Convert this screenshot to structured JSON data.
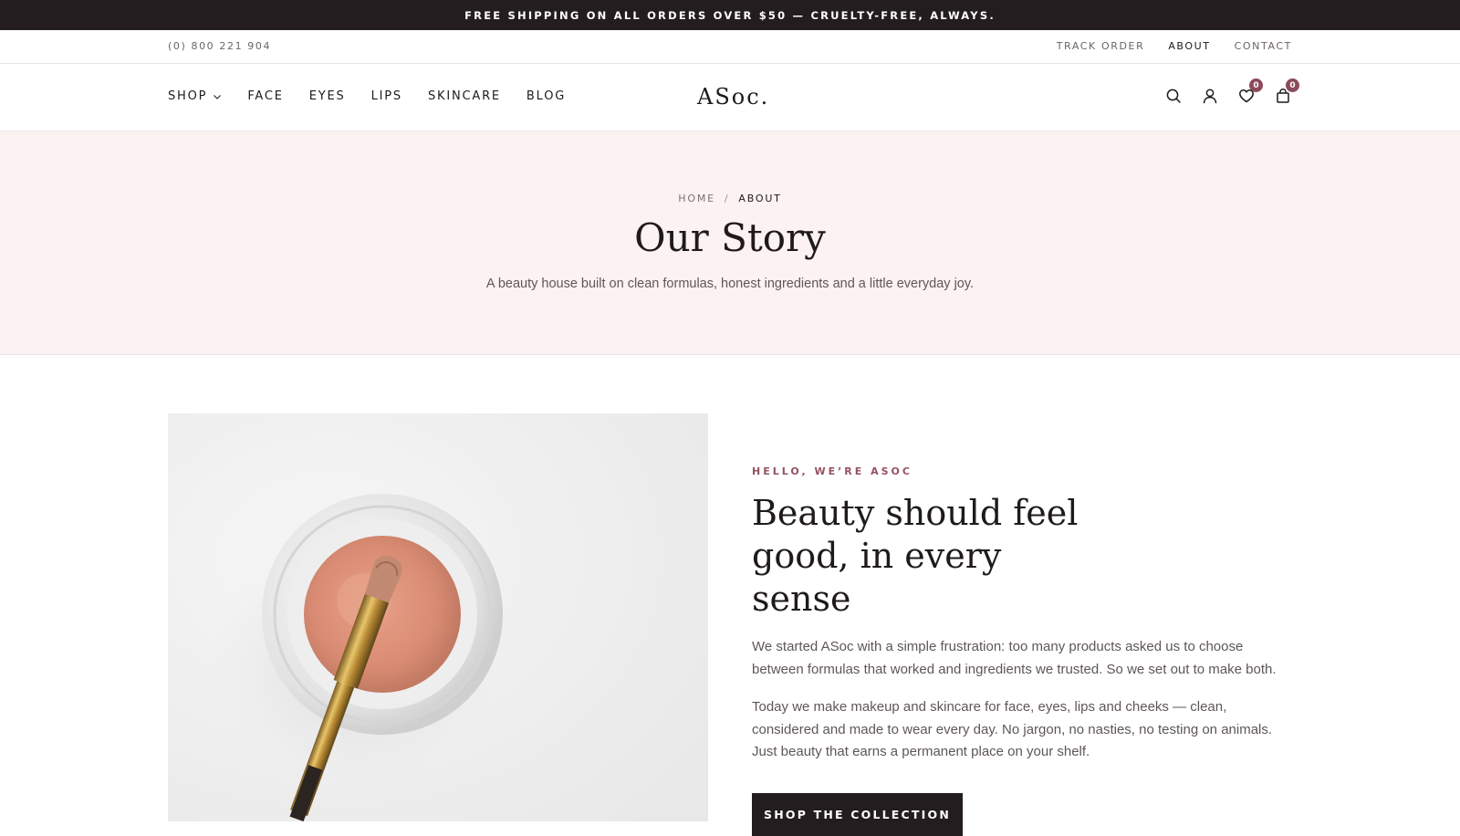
{
  "announcement": "FREE SHIPPING ON ALL ORDERS OVER $50 — CRUELTY-FREE, ALWAYS.",
  "utility": {
    "phone": "(0) 800 221 904",
    "links": [
      "TRACK ORDER",
      "ABOUT",
      "CONTACT"
    ],
    "active": "ABOUT"
  },
  "nav": {
    "items": [
      "SHOP",
      "FACE",
      "EYES",
      "LIPS",
      "SKINCARE",
      "BLOG"
    ],
    "logo": "ASoc.",
    "wishlist_count": "0",
    "cart_count": "0",
    "icons": [
      "search-icon",
      "user-icon",
      "heart-icon",
      "bag-icon",
      "chevron-down-icon"
    ]
  },
  "hero": {
    "breadcrumb": {
      "home": "HOME",
      "separator": "/",
      "current": "ABOUT"
    },
    "title": "Our Story",
    "subtitle": "A beauty house built on clean formulas, honest ingredients and a little everyday joy."
  },
  "intro": {
    "eyebrow": "HELLO, WE’RE ASOC",
    "heading": "Beauty should feel good, in every sense",
    "paragraph1": "We started ASoc with a simple frustration: too many products asked us to choose between formulas that worked and ingredients we trusted. So we set out to make both.",
    "paragraph2": "Today we make makeup and skincare for face, eyes, lips and cheeks — clean, considered and made to wear every day. No jargon, no nasties, no testing on animals. Just beauty that earns a permanent place on your shelf.",
    "cta": "SHOP THE COLLECTION"
  },
  "colors": {
    "dark": "#231d20",
    "accent": "#94515f",
    "badge": "#8c4a5a",
    "hero_bg": "#fcf2f2"
  }
}
